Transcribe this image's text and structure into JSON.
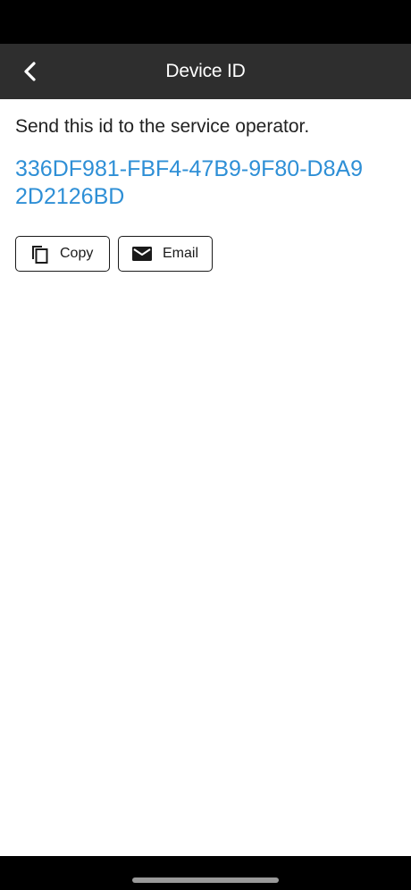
{
  "header": {
    "title": "Device ID",
    "back_icon": "chevron-left-icon"
  },
  "main": {
    "instruction": "Send this id to the service operator.",
    "device_id": "336DF981-FBF4-47B9-9F80-D8A92D2126BD",
    "buttons": [
      {
        "label": "Copy",
        "icon": "copy-icon"
      },
      {
        "label": "Email",
        "icon": "mail-icon"
      }
    ]
  },
  "colors": {
    "app_bar": "#2e2e2e",
    "link": "#2e8fd6",
    "background": "#ffffff"
  }
}
